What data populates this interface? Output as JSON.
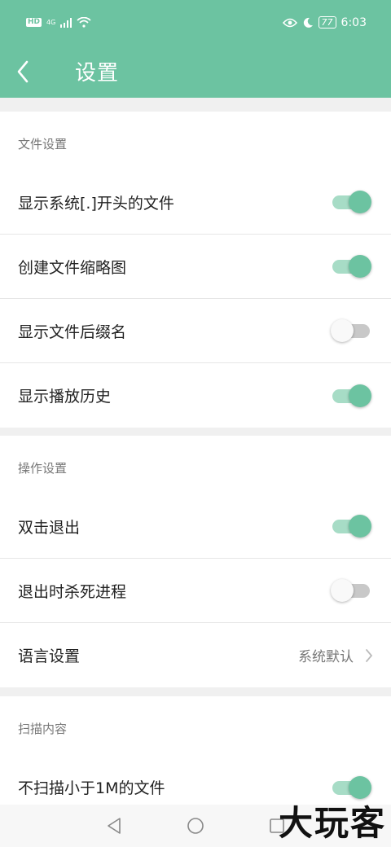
{
  "status_bar": {
    "hd": "HD",
    "network": "4G",
    "battery": "77",
    "time": "6:03"
  },
  "app_bar": {
    "title": "设置"
  },
  "sections": [
    {
      "title": "文件设置",
      "rows": [
        {
          "label": "显示系统[.]开头的文件",
          "toggle": true
        },
        {
          "label": "创建文件缩略图",
          "toggle": true
        },
        {
          "label": "显示文件后缀名",
          "toggle": false
        },
        {
          "label": "显示播放历史",
          "toggle": true
        }
      ]
    },
    {
      "title": "操作设置",
      "rows": [
        {
          "label": "双击退出",
          "toggle": true
        },
        {
          "label": "退出时杀死进程",
          "toggle": false
        },
        {
          "label": "语言设置",
          "value": "系统默认"
        }
      ]
    },
    {
      "title": "扫描内容",
      "rows": [
        {
          "label": "不扫描小于1M的文件",
          "toggle": true
        }
      ]
    }
  ],
  "watermark": "大玩客",
  "colors": {
    "accent": "#6cc3a1",
    "accent_light": "#a7dcc6",
    "toggle_off_track": "#c8c8c8"
  }
}
